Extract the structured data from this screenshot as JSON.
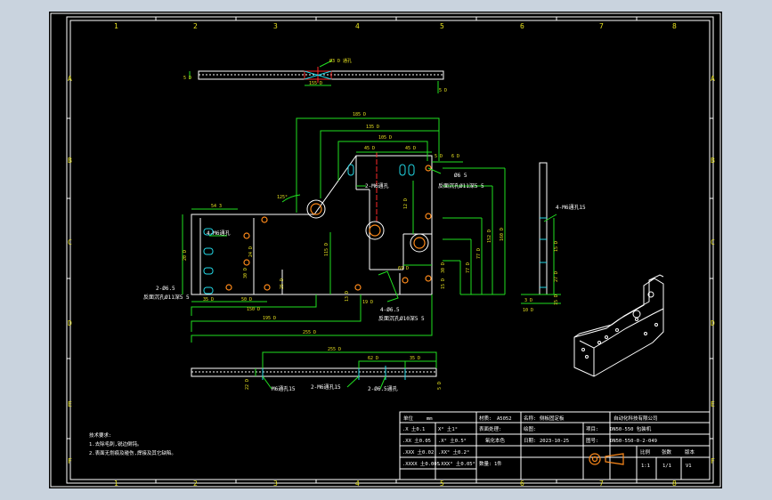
{
  "border": {
    "top_numbers": [
      "1",
      "2",
      "3",
      "4",
      "5",
      "6",
      "7",
      "8"
    ],
    "bottom_numbers": [
      "1",
      "2",
      "3",
      "4",
      "5",
      "6",
      "7",
      "8"
    ],
    "left_letters": [
      "A",
      "B",
      "C",
      "D",
      "E",
      "F"
    ],
    "right_letters": [
      "A",
      "B",
      "C",
      "D",
      "E",
      "F"
    ]
  },
  "dims_top": {
    "width": "155 D",
    "hole": "Ø3 D 通孔",
    "thick": "5 D"
  },
  "dims_front": {
    "d185": "185 D",
    "d135": "135 D",
    "d105": "105 D",
    "d45a": "45 D",
    "d45b": "45 D",
    "d50": "5 D",
    "d60": "6 D",
    "d54": "54 3",
    "d150": "150 D",
    "d195": "195 D",
    "d255": "255 D",
    "d35": "35 D",
    "d50b": "50 D",
    "d115": "115 D",
    "angle": "125°",
    "d152": "152 D",
    "d160": "160 D",
    "d77": "77 D",
    "d30": "30 D",
    "d15": "15 D",
    "d20": "20 D",
    "d69": "69 D",
    "d71": "77 D",
    "d53": "30 D",
    "d94": "24 D",
    "d25": "25 D",
    "d19": "19 D",
    "d12": "12 D",
    "d13": "13 D"
  },
  "callouts_front": {
    "c1": "2-M6通孔",
    "c2": "Ø6 5",
    "c3": "反面沉孔Ø11深5 5",
    "c4": "4-M6通孔",
    "c5": "2-Ø6.5",
    "c6": "反面沉孔Ø11深5 5",
    "c7": "4-Ø6.5",
    "c8": "反面沉孔Ø10深5 5"
  },
  "dims_bottom": {
    "d255": "255 D",
    "d62": "62 D",
    "d35": "35 D",
    "d22": "22 D",
    "d5": "5 D"
  },
  "callouts_bottom": {
    "c1": "M6通孔15",
    "c2": "2-M6通孔15",
    "c3": "2-Ø6.5通孔"
  },
  "dims_side": {
    "callout": "4-M6通孔15",
    "d30": "3 D",
    "d10": "10 D",
    "d15a": "15 D",
    "d15b": "15 D",
    "d27": "27 D",
    "d29": "29 D"
  },
  "notes": {
    "title": "技术要求:",
    "line1": "1.去除毛刺,锐边倒钝。",
    "line2": "2.表面无划痕及碰伤,焊接及其它缺陷。"
  },
  "title_block": {
    "unit_label": "单位",
    "unit_value": "mm",
    "material_label": "材质:",
    "material_value": "A5052",
    "name_label": "名称:",
    "name_value": "侧板固定板",
    "company": "自动化科技有限公司",
    "treatment_label": "表面处理:",
    "treatment_value": "氧化本色",
    "drawing_label": "绘图:",
    "date_label": "日期:",
    "date_value": "2023-10-25",
    "qty_label": "数量:",
    "qty_value": "1件",
    "project_label": "项目:",
    "project_value": "DN50-550 包装机",
    "code_label": "图号:",
    "code_value": "DN50-550-0-2-049",
    "scale_label": "比例",
    "sheet_label": "张数",
    "revision_label": "版本",
    "scale_value": "1:1",
    "sheet_value": "1/1",
    "revision_value": "V1",
    "tol_rows": [
      [
        ".X 土0.1",
        "X° 土1°"
      ],
      [
        ".XX 土0.05",
        ".X° 土0.5°"
      ],
      [
        ".XXX 土0.02",
        ".XX° 土0.2°"
      ],
      [
        ".XXXX 土0.005",
        ".XXX° 土0.05°"
      ]
    ]
  }
}
